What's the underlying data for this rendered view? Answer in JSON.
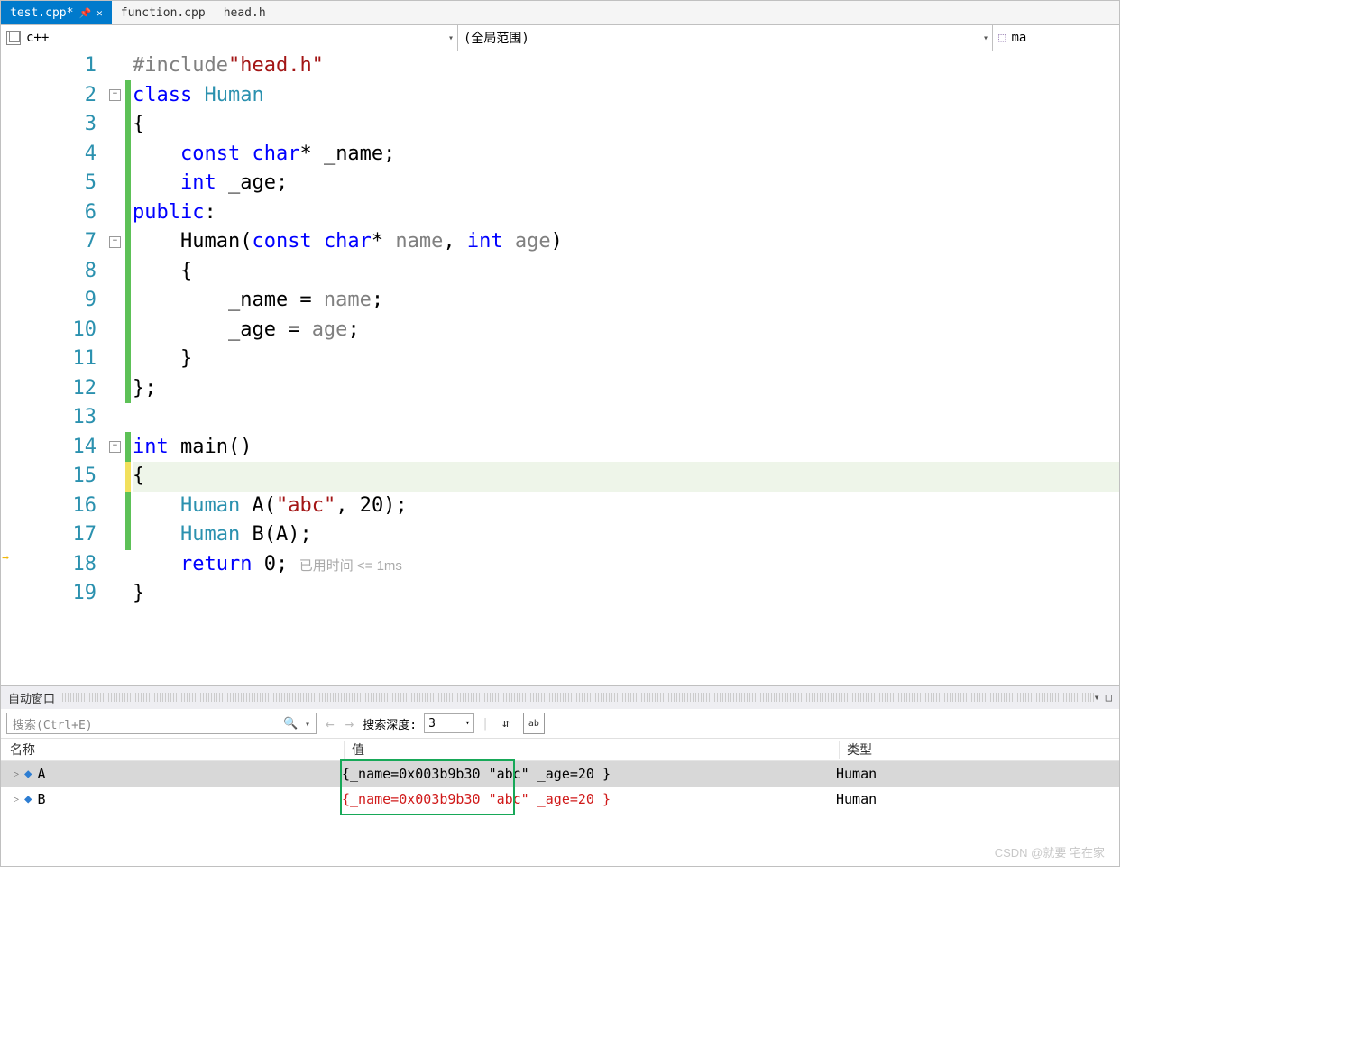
{
  "tabs": [
    {
      "label": "test.cpp*",
      "active": true
    },
    {
      "label": "function.cpp",
      "active": false
    },
    {
      "label": "head.h",
      "active": false
    }
  ],
  "nav": {
    "lang": "c++",
    "scope": "(全局范围)",
    "member": "ma"
  },
  "code": {
    "lines": [
      "1",
      "2",
      "3",
      "4",
      "5",
      "6",
      "7",
      "8",
      "9",
      "10",
      "11",
      "12",
      "13",
      "14",
      "15",
      "16",
      "17",
      "18",
      "19"
    ],
    "l1_pp": "#include",
    "l1_str": "\"head.h\"",
    "l2_kw": "class",
    "l2_ty": " Human",
    "l3": "{",
    "l4a": "    ",
    "l4_kw": "const",
    "l4b": " ",
    "l4_kw2": "char",
    "l4c": "* _name;",
    "l5a": "    ",
    "l5_kw": "int",
    "l5b": " _age;",
    "l6_kw": "public",
    "l6b": ":",
    "l7a": "    Human(",
    "l7_kw": "const",
    "l7b": " ",
    "l7_kw2": "char",
    "l7c": "* ",
    "l7_p1": "name",
    "l7d": ", ",
    "l7_kw3": "int",
    "l7e": " ",
    "l7_p2": "age",
    "l7f": ")",
    "l8": "    {",
    "l9a": "        _name = ",
    "l9b": "name",
    "l9c": ";",
    "l10a": "        _age = ",
    "l10b": "age",
    "l10c": ";",
    "l11": "    }",
    "l12": "};",
    "l14_kw": "int",
    "l14b": " main()",
    "l15": "{",
    "l16a": "    ",
    "l16_ty": "Human",
    "l16b": " A(",
    "l16_str": "\"abc\"",
    "l16c": ", 20);",
    "l17a": "    ",
    "l17_ty": "Human",
    "l17b": " B(A);",
    "l18a": "    ",
    "l18_kw": "return",
    "l18b": " 0;",
    "l18_hint": "   已用时间 <= 1ms",
    "l19": "}"
  },
  "panel": {
    "title": "自动窗口",
    "search_placeholder": "搜索(Ctrl+E)",
    "depth_label": "搜索深度:",
    "depth_value": "3",
    "columns": {
      "name": "名称",
      "value": "值",
      "type": "类型"
    },
    "rows": [
      {
        "name": "A",
        "value_addr": "{_name=0x003b9b30 ",
        "value_rest": "\"abc\" _age=20 }",
        "type": "Human",
        "changed": false
      },
      {
        "name": "B",
        "value_addr": "{_name=0x003b9b30 ",
        "value_rest": "\"abc\" _age=20 }",
        "type": "Human",
        "changed": true
      }
    ]
  },
  "watermark": "CSDN @就要 宅在家"
}
